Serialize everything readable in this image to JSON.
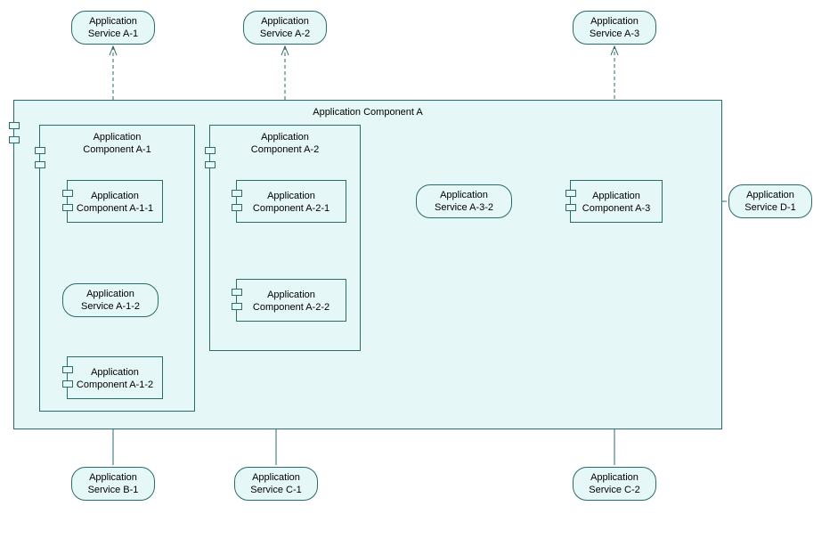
{
  "services": {
    "a1": "Application\nService A-1",
    "a2": "Application\nService A-2",
    "a3": "Application\nService A-3",
    "a12": "Application\nService A-1-2",
    "a32": "Application\nService A-3-2",
    "b1": "Application\nService B-1",
    "c1": "Application\nService C-1",
    "c2": "Application\nService C-2",
    "d1": "Application\nService D-1"
  },
  "components": {
    "a": "Application Component A",
    "a1": "Application\nComponent A-1",
    "a2": "Application\nComponent A-2",
    "a11": "Application\nComponent A-1-1",
    "a12": "Application\nComponent A-1-2",
    "a21": "Application\nComponent A-2-1",
    "a22": "Application\nComponent A-2-2",
    "a3": "Application\nComponent A-3"
  }
}
